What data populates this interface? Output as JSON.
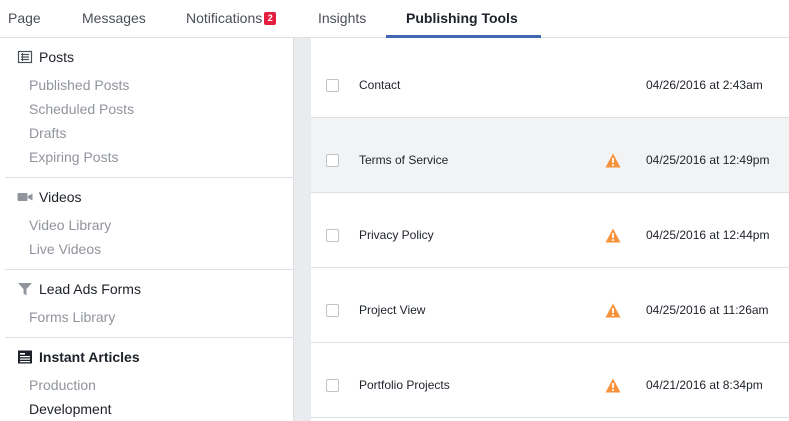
{
  "tabs": [
    {
      "label": "Page"
    },
    {
      "label": "Messages"
    },
    {
      "label": "Notifications",
      "badge": "2"
    },
    {
      "label": "Insights"
    },
    {
      "label": "Publishing Tools",
      "active": true
    }
  ],
  "sidebar": {
    "posts": {
      "title": "Posts",
      "icon": "list-icon",
      "items": [
        "Published Posts",
        "Scheduled Posts",
        "Drafts",
        "Expiring Posts"
      ]
    },
    "videos": {
      "title": "Videos",
      "icon": "video-camera-icon",
      "items": [
        "Video Library",
        "Live Videos"
      ]
    },
    "lead_ads": {
      "title": "Lead Ads Forms",
      "icon": "filter-icon",
      "items": [
        "Forms Library"
      ]
    },
    "instant_articles": {
      "title": "Instant Articles",
      "icon": "article-icon",
      "items": [
        "Production",
        "Development"
      ],
      "current": "Development"
    }
  },
  "rows": [
    {
      "title": "Contact",
      "warning": false,
      "date": "04/26/2016 at 2:43am"
    },
    {
      "title": "Terms of Service",
      "warning": true,
      "date": "04/25/2016 at 12:49pm"
    },
    {
      "title": "Privacy Policy",
      "warning": true,
      "date": "04/25/2016 at 12:44pm"
    },
    {
      "title": "Project View",
      "warning": true,
      "date": "04/25/2016 at 11:26am"
    },
    {
      "title": "Portfolio Projects",
      "warning": true,
      "date": "04/21/2016 at 8:34pm"
    }
  ],
  "colors": {
    "accent": "#4267b2",
    "badge": "#e41e3f",
    "warning": "#f7923b"
  }
}
